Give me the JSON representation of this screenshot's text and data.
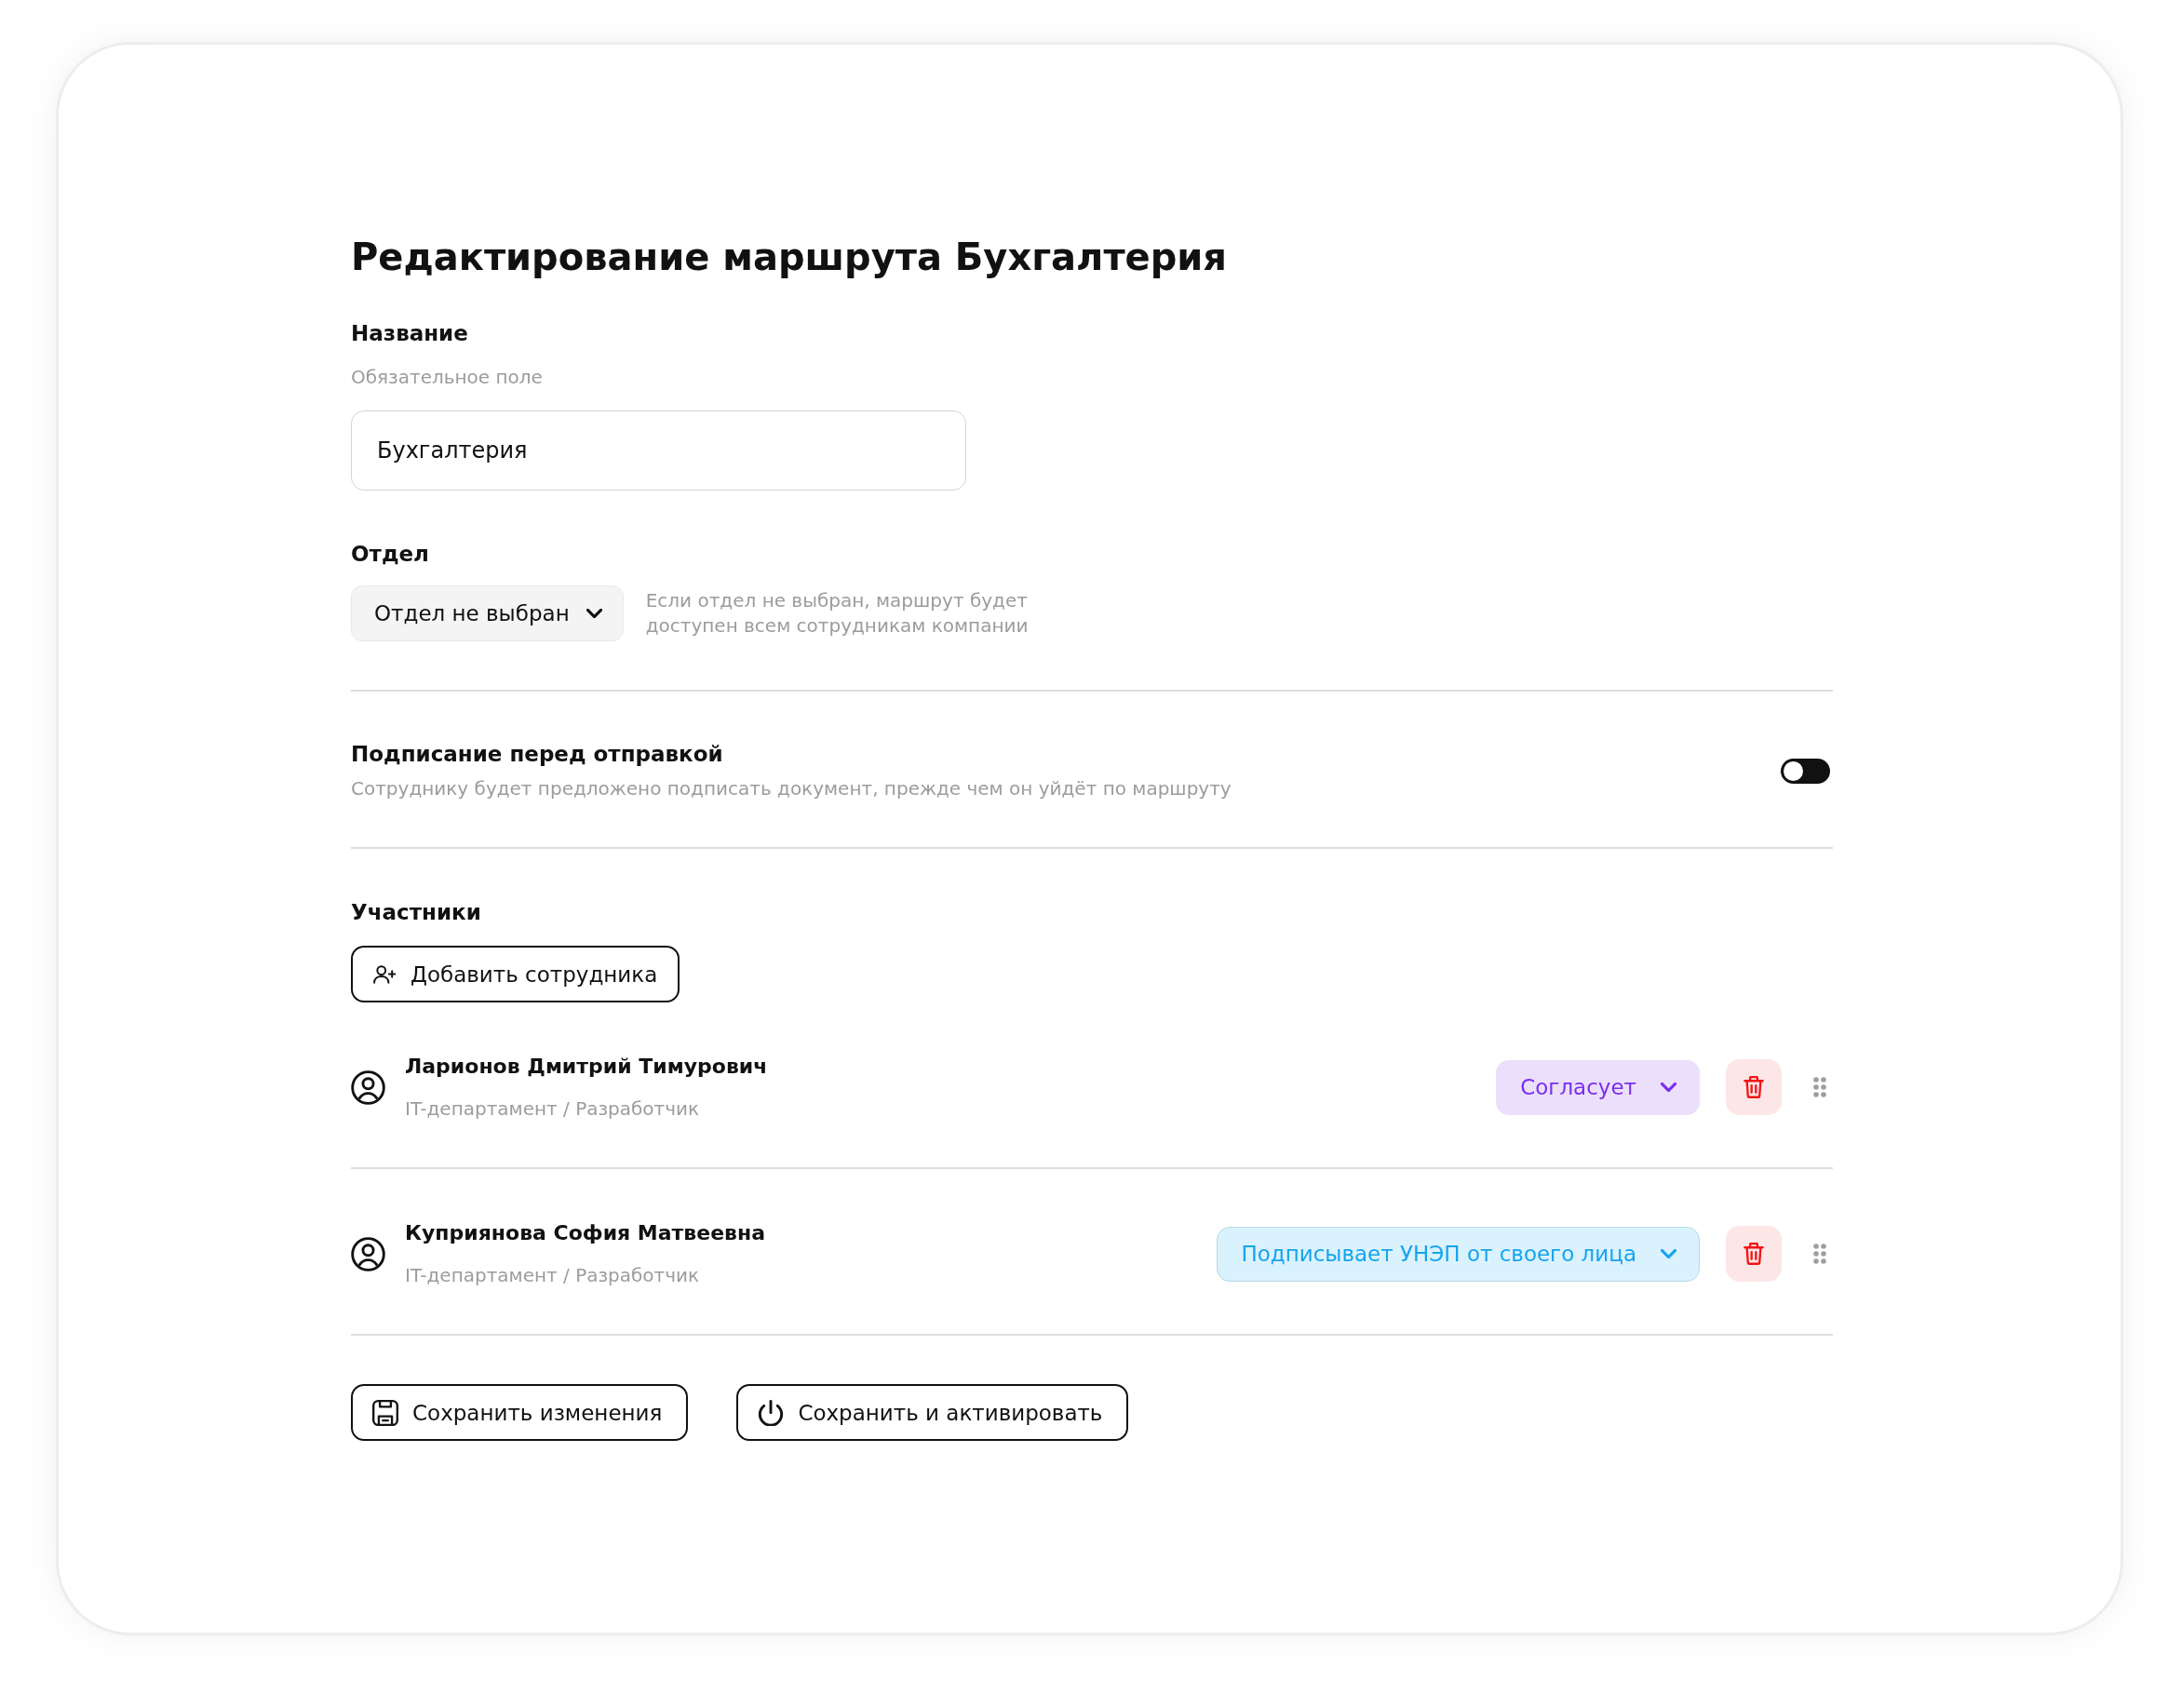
{
  "title": "Редактирование маршрута Бухгалтерия",
  "name_field": {
    "label": "Название",
    "hint": "Обязательное поле",
    "value": "Бухгалтерия"
  },
  "department": {
    "label": "Отдел",
    "value": "Отдел не выбран",
    "note": "Если отдел не выбран, маршрут будет доступен всем сотрудникам компании"
  },
  "sign_before_send": {
    "title": "Подписание перед отправкой",
    "description": "Сотруднику будет предложено подписать документ, прежде чем он уйдёт по маршруту",
    "on": false
  },
  "participants": {
    "heading": "Участники",
    "add_button": "Добавить сотрудника",
    "items": [
      {
        "name": "Ларионов Дмитрий Тимурович",
        "subtitle": "IT-департамент / Разработчик",
        "role": {
          "label": "Согласует",
          "kind": "approve"
        }
      },
      {
        "name": "Куприянова София Матвеевна",
        "subtitle": "IT-департамент / Разработчик",
        "role": {
          "label": "Подписывает УНЭП от своего лица",
          "kind": "sign"
        }
      }
    ]
  },
  "actions": [
    {
      "label": "Сохранить изменения",
      "kind": "save"
    },
    {
      "label": "Сохранить и активировать",
      "kind": "activate"
    }
  ]
}
